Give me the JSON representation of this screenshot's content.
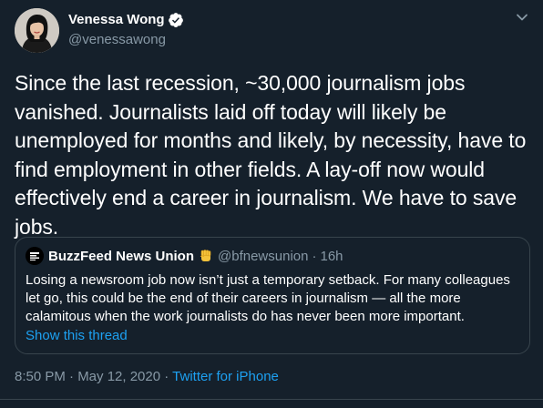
{
  "author": {
    "display_name": "Venessa Wong",
    "handle": "@venessawong",
    "verified": true,
    "avatar_icon": "profile-photo"
  },
  "tweet": {
    "text": "Since the last recession, ~30,000 journalism jobs vanished. Journalists laid off today will likely be unemployed for months and likely, by necessity, have to find employment in other fields. A lay-off now would effectively end a career in journalism. We have to save jobs."
  },
  "quoted_tweet": {
    "display_name": "BuzzFeed News Union",
    "emoji_icon": "raised-fist-icon",
    "handle": "@bfnewsunion",
    "separator": "·",
    "time": "16h",
    "text": "Losing a newsroom job now isn’t just a temporary setback. For many colleagues let go, this could be the end of their careers in journalism — all the more calamitous when the work journalists do has never been more important.",
    "show_thread_label": "Show this thread"
  },
  "meta": {
    "timestamp": "8:50 PM · May 12, 2020",
    "separator": " · ",
    "source": "Twitter for iPhone"
  },
  "colors": {
    "background": "#15202b",
    "text": "#ffffff",
    "secondary_text": "#8899a6",
    "accent": "#1da1f2",
    "border": "#38444d"
  }
}
